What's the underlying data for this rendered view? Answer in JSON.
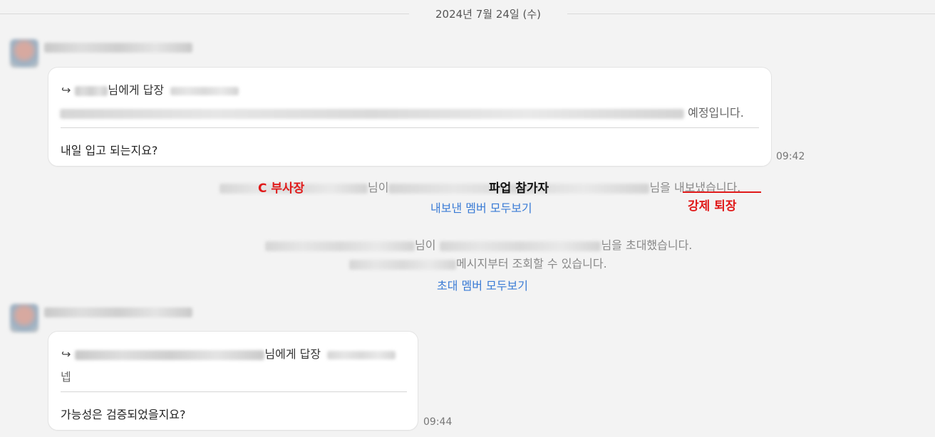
{
  "date_divider": "2024년 7월 24일 (수)",
  "message1": {
    "reply_suffix": "님에게 답장",
    "quote_suffix": "예정입니다.",
    "text": "내일 입고 되는지요?",
    "time": "09:42"
  },
  "system_kick": {
    "mid": "님이",
    "end": "님을 내보냈습니다.",
    "link": "내보낸 멤버 모두보기"
  },
  "system_invite": {
    "mid": "님이",
    "end": "님을 초대했습니다.",
    "line2": "메시지부터 조회할 수 있습니다.",
    "link": "초대 멤버 모두보기"
  },
  "message2": {
    "reply_suffix": "님에게 답장",
    "quote": "넵",
    "text": "가능성은 검증되었을지요?",
    "time": "09:44"
  },
  "annotations": {
    "kicker": "C 부사장",
    "kicked": "파업 참가자",
    "action": "강제 퇴장"
  },
  "colors": {
    "link": "#3a7bd5",
    "annotation_red": "#e01919"
  }
}
